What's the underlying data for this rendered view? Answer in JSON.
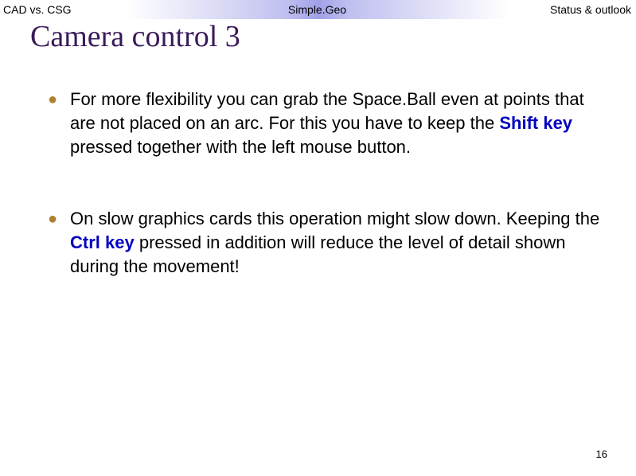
{
  "header": {
    "left": "CAD vs. CSG",
    "center": "Simple.Geo",
    "right": "Status & outlook"
  },
  "title": "Camera control 3",
  "bullets": [
    {
      "before": "For more flexibility you can grab the Space.Ball even at points that are not placed on an arc. For this you have to keep the ",
      "highlight": "Shift key",
      "after": " pressed together with the left mouse button."
    },
    {
      "before": "On slow graphics cards this operation might slow down. Keeping the ",
      "highlight": "Ctrl key",
      "after": " pressed in addition will reduce the level of detail shown during the movement!"
    }
  ],
  "page_number": "16"
}
